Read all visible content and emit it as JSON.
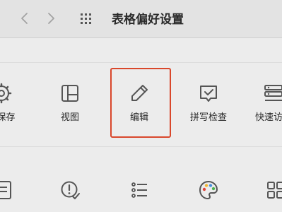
{
  "window": {
    "title": "表格偏好设置"
  },
  "prefs_row1": [
    {
      "label": "与保存",
      "icon": "gear-icon"
    },
    {
      "label": "视图",
      "icon": "view-icon"
    },
    {
      "label": "编辑",
      "icon": "pencil-icon"
    },
    {
      "label": "拼写检查",
      "icon": "spellcheck-icon"
    },
    {
      "label": "快速访问",
      "icon": "quick-access-icon"
    }
  ],
  "prefs_row2": [
    {
      "label": "",
      "icon": "document-list-icon"
    },
    {
      "label": "",
      "icon": "error-check-icon"
    },
    {
      "label": "",
      "icon": "list-icon"
    },
    {
      "label": "",
      "icon": "palette-icon"
    },
    {
      "label": "",
      "icon": "grid-apps-icon"
    }
  ],
  "colors": {
    "highlight": "#d9472b",
    "toolbar": "#e3e3e3",
    "background": "#ececec"
  }
}
